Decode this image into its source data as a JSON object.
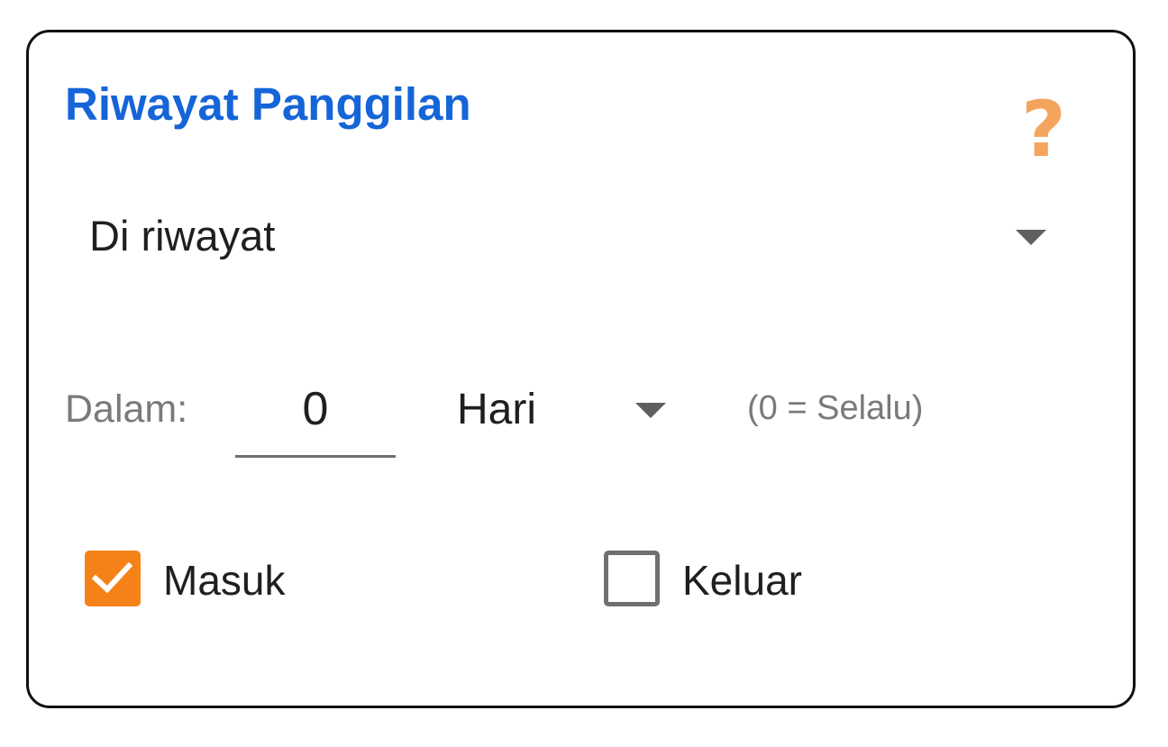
{
  "dialog": {
    "title": "Riwayat Panggilan",
    "help_icon": "question-mark-icon",
    "help_glyph": "?",
    "accent_color": "#1565d8",
    "help_color": "#f5a45d"
  },
  "history_select": {
    "selected": "Di riwayat",
    "icon": "chevron-down-icon"
  },
  "range": {
    "label": "Dalam:",
    "value": "0",
    "unit": "Hari",
    "unit_icon": "chevron-down-icon",
    "hint": "(0 = Selalu)"
  },
  "call_types": [
    {
      "label": "Masuk",
      "checked": true
    },
    {
      "label": "Keluar",
      "checked": false
    }
  ],
  "checkbox_color": "#f58219"
}
